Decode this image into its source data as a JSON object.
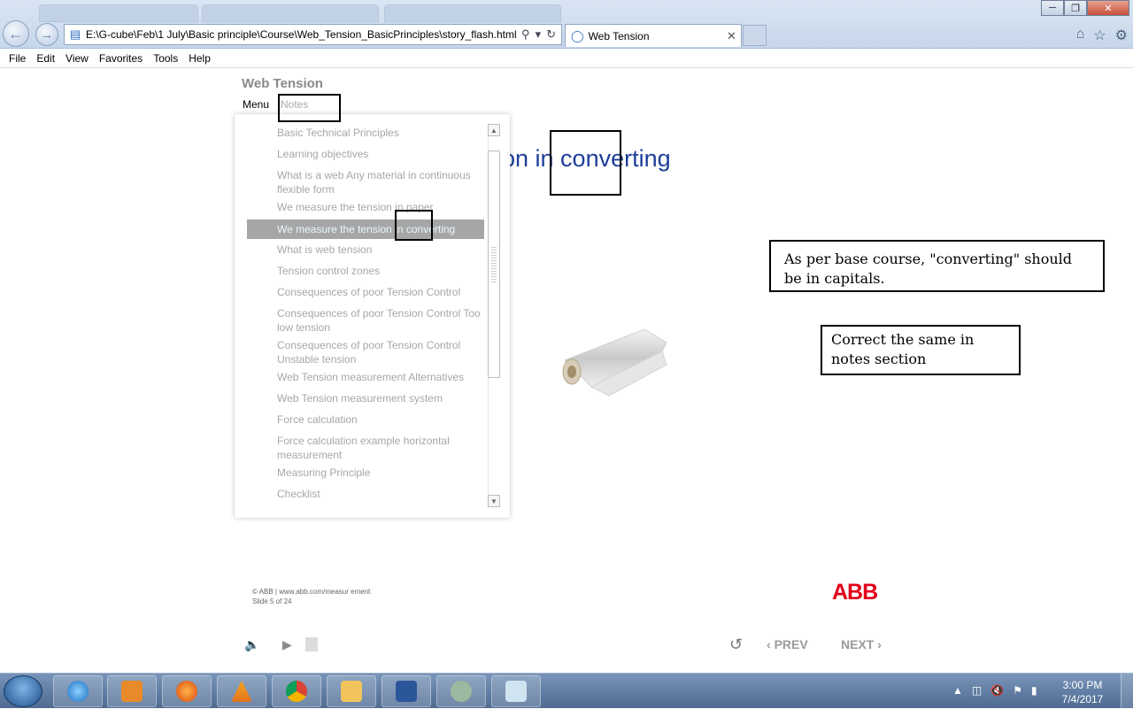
{
  "browser": {
    "url": "E:\\G-cube\\Feb\\1 July\\Basic principle\\Course\\Web_Tension_BasicPrinciples\\story_flash.html",
    "tab_title": "Web Tension"
  },
  "menubar": [
    "File",
    "Edit",
    "View",
    "Favorites",
    "Tools",
    "Help"
  ],
  "player": {
    "course_title": "Web Tension",
    "tabs": {
      "menu": "Menu",
      "notes": "Notes"
    },
    "menu_items": [
      "Basic Technical Principles",
      "Learning objectives",
      "What is a web Any material in continuous flexible form",
      "We measure the tension in paper",
      "We measure the tension in converting",
      "What is web tension",
      "Tension control zones",
      "Consequences of poor Tension Control",
      "Consequences of poor Tension Control Too low tension",
      "Consequences of poor Tension Control Unstable tension",
      "Web Tension measurement Alternatives",
      "Web Tension measurement system",
      "Force calculation",
      "Force calculation example horizontal measurement",
      "Measuring Principle",
      "Checklist"
    ],
    "active_index": 4,
    "slide_heading_visible": "on in converting",
    "footer": {
      "copyright": "© ABB | www.abb.com/measur ement",
      "slide_counter": "Slide 5 of 24"
    },
    "logo": "ABB",
    "nav": {
      "prev": "PREV",
      "next": "NEXT"
    }
  },
  "annotations": {
    "note1": "As per base course, \"converting\" should be in capitals.",
    "note2": "Correct the same in notes section"
  },
  "taskbar": {
    "time": "3:00 PM",
    "date": "7/4/2017"
  }
}
